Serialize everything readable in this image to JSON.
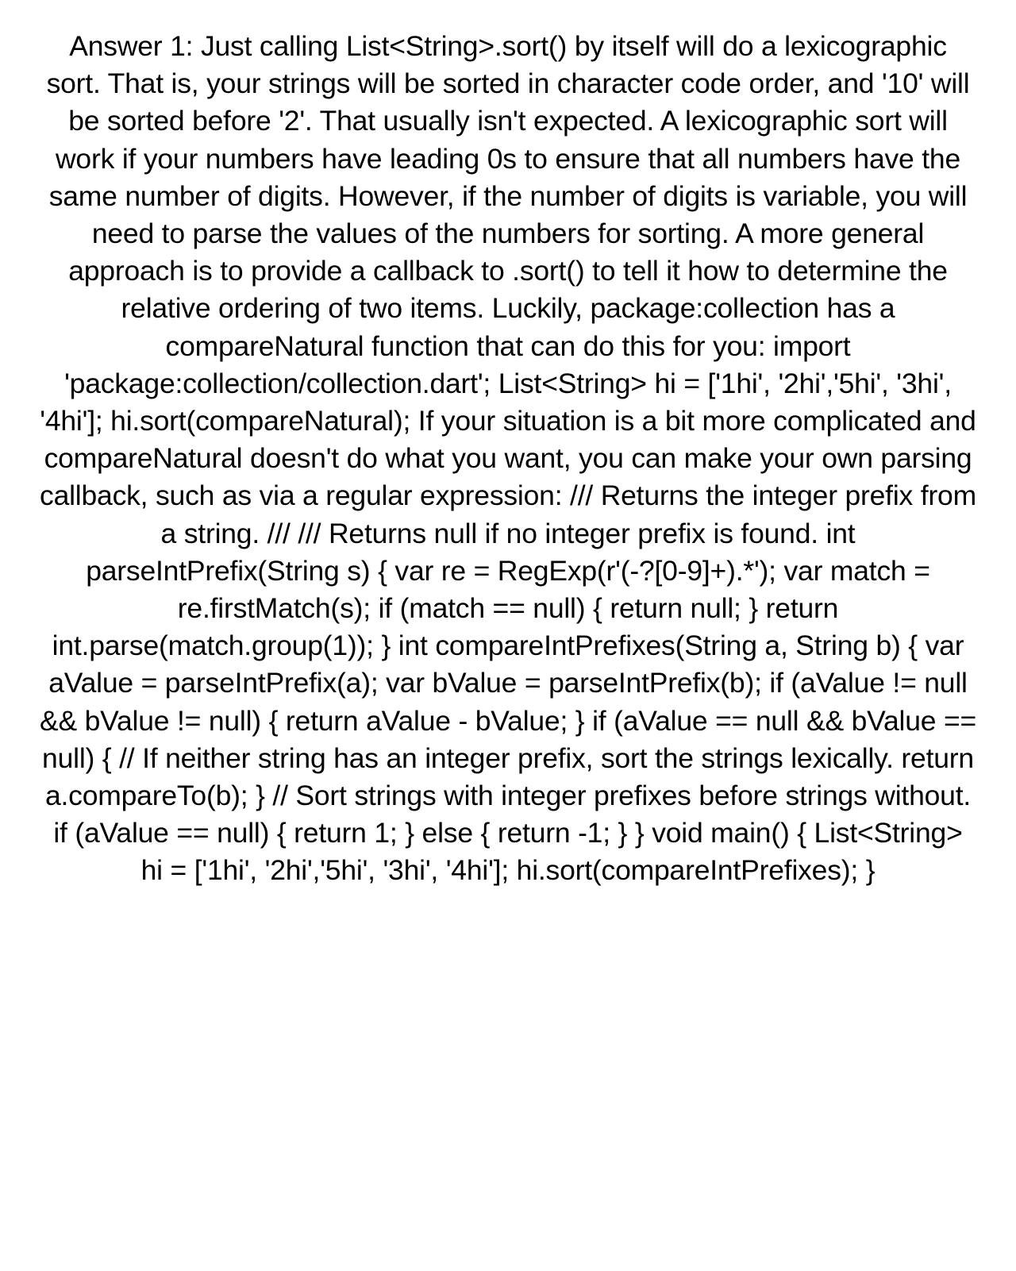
{
  "document": {
    "text": "Answer 1: Just calling List<String>.sort() by itself will do a lexicographic sort.  That is, your strings will be sorted in character code order, and '10' will be sorted before '2'. That usually isn't expected. A lexicographic sort will work if your numbers have leading 0s to ensure that all numbers have the same number of digits.  However, if the number of digits is variable, you will need to parse the values of the numbers for sorting.  A more general approach is to provide a callback to .sort() to tell it how to determine the relative ordering of two items. Luckily, package:collection has a compareNatural function that can do this for you: import 'package:collection/collection.dart';  List<String> hi = ['1hi', '2hi','5hi', '3hi', '4hi']; hi.sort(compareNatural);  If your situation is a bit more complicated and compareNatural doesn't do what you want, you can make your own parsing callback, such as via a regular expression: /// Returns the integer prefix from a string. /// /// Returns null if no integer prefix is found. int parseIntPrefix(String s) {   var re = RegExp(r'(-?[0-9]+).*');   var match = re.firstMatch(s);   if (match == null) {     return null;   }   return int.parse(match.group(1)); }  int compareIntPrefixes(String a, String b) {   var aValue = parseIntPrefix(a);   var bValue = parseIntPrefix(b);   if (aValue != null && bValue != null) {     return aValue - bValue;   }   if (aValue == null && bValue == null) {     // If neither string has an integer prefix, sort the strings lexically.     return a.compareTo(b);   }   // Sort strings with integer prefixes before strings without.   if (aValue == null) {     return 1;   } else {     return -1;   } }  void main() {   List<String> hi = ['1hi', '2hi','5hi', '3hi', '4hi'];   hi.sort(compareIntPrefixes); }"
  }
}
